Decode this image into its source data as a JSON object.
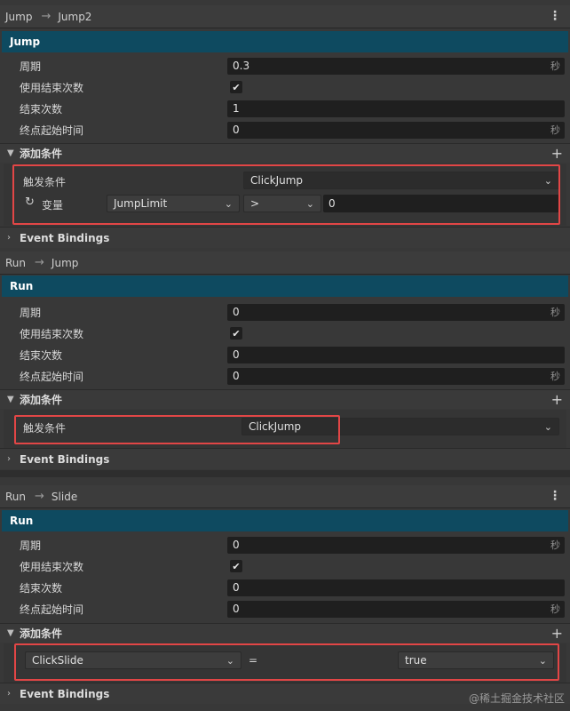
{
  "panels": [
    {
      "header": {
        "from": "Jump",
        "to": "Jump2"
      },
      "title": "Jump",
      "fields": {
        "period_label": "周期",
        "period_value": "0.3",
        "period_unit": "秒",
        "use_end_label": "使用结束次数",
        "end_count_label": "结束次数",
        "end_count_value": "1",
        "end_start_label": "终点起始时间",
        "end_start_value": "0",
        "end_start_unit": "秒"
      },
      "add_condition_label": "添加条件",
      "trigger_label": "触发条件",
      "trigger_value": "ClickJump",
      "variable_label": "变量",
      "variable_name": "JumpLimit",
      "variable_op": ">",
      "variable_value": "0",
      "event_bindings_label": "Event Bindings"
    },
    {
      "header": {
        "from": "Run",
        "to": "Jump"
      },
      "title": "Run",
      "fields": {
        "period_label": "周期",
        "period_value": "0",
        "period_unit": "秒",
        "use_end_label": "使用结束次数",
        "end_count_label": "结束次数",
        "end_count_value": "0",
        "end_start_label": "终点起始时间",
        "end_start_value": "0",
        "end_start_unit": "秒"
      },
      "add_condition_label": "添加条件",
      "trigger_label": "触发条件",
      "trigger_value": "ClickJump",
      "event_bindings_label": "Event Bindings"
    },
    {
      "header": {
        "from": "Run",
        "to": "Slide"
      },
      "title": "Run",
      "fields": {
        "period_label": "周期",
        "period_value": "0",
        "period_unit": "秒",
        "use_end_label": "使用结束次数",
        "end_count_label": "结束次数",
        "end_count_value": "0",
        "end_start_label": "终点起始时间",
        "end_start_value": "0",
        "end_start_unit": "秒"
      },
      "add_condition_label": "添加条件",
      "cond_left": "ClickSlide",
      "cond_op": "=",
      "cond_right": "true",
      "event_bindings_label": "Event Bindings"
    }
  ],
  "icons": {
    "arrow": "arrow-right-icon",
    "menu": "kebab-menu-icon",
    "plus": "plus-icon",
    "chevron": "chevron-down-icon",
    "check": "checkmark-icon",
    "refresh": "refresh-icon"
  },
  "colors": {
    "title_bar": "#0e4a60",
    "highlight": "#e24646",
    "background": "#383838"
  },
  "watermark": "@稀土掘金技术社区"
}
